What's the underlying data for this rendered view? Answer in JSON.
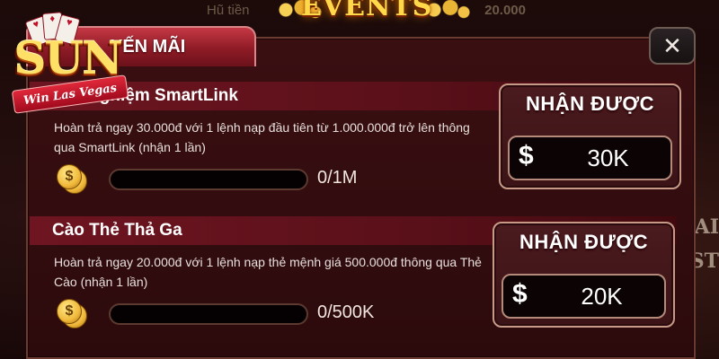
{
  "background": {
    "jackpot_label": "Hũ tiền",
    "jackpot_amount": "20.000",
    "events_title": "EVENTS",
    "side_text_1": "AI",
    "side_text_2": "EST"
  },
  "logo": {
    "brand": "SUN",
    "tagline": "Win Las Vegas"
  },
  "tab": {
    "label": "YẾN MÃI"
  },
  "close_button": {
    "icon": "close-icon",
    "glyph": "✕"
  },
  "promotions": [
    {
      "title": "Trải Nghiệm SmartLink",
      "description": "Hoàn trả ngay 30.000đ với 1 lệnh nạp đầu tiên từ 1.000.000đ trở lên thông qua SmartLink (nhận 1 lần)",
      "progress_text": "0/1M",
      "progress": 0,
      "reward_label": "NHẬN ĐƯỢC",
      "currency_symbol": "$",
      "reward_value": "30K"
    },
    {
      "title": "Cào Thẻ Thả Ga",
      "description": "Hoàn trả ngay 20.000đ với 1 lệnh nạp thẻ mệnh giá 500.000đ thông qua Thẻ Cào (nhận 1 lần)",
      "progress_text": "0/500K",
      "progress": 0,
      "reward_label": "NHẬN ĐƯỢC",
      "currency_symbol": "$",
      "reward_value": "20K"
    }
  ],
  "colors": {
    "modal_bg": "#2c0a0c",
    "tab_red": "#c43844",
    "header_red": "#6e1521",
    "gold": "#ffd94a"
  }
}
